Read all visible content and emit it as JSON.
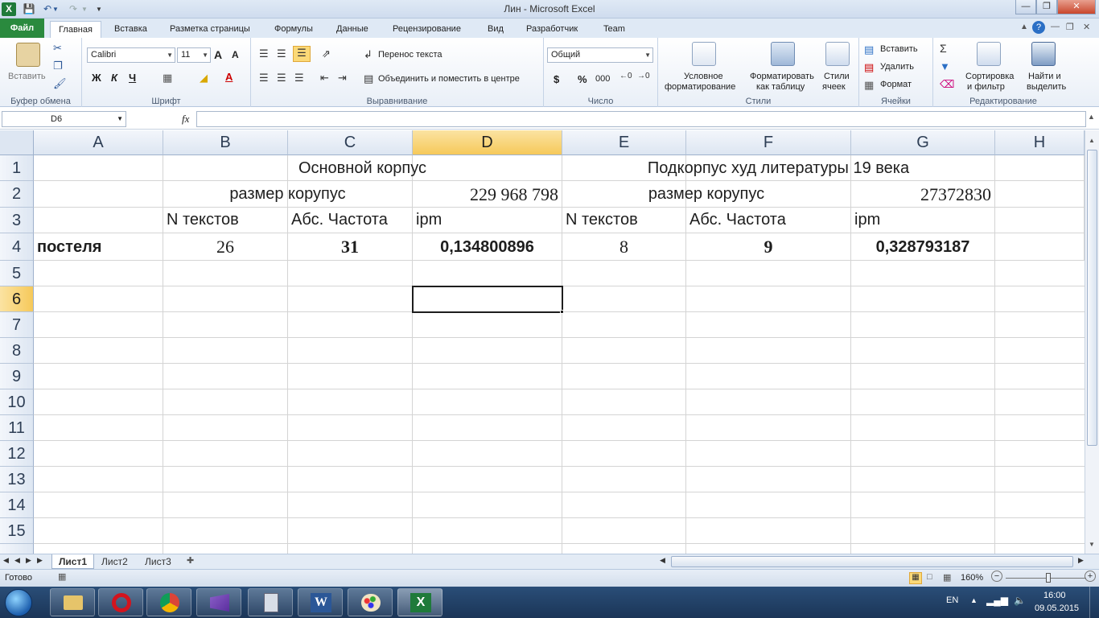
{
  "window": {
    "title": "Лин  -  Microsoft Excel"
  },
  "tabs": [
    "Файл",
    "Главная",
    "Вставка",
    "Разметка страницы",
    "Формулы",
    "Данные",
    "Рецензирование",
    "Вид",
    "Разработчик",
    "Team"
  ],
  "ribbon": {
    "clipboard": {
      "paste": "Вставить",
      "label": "Буфер обмена"
    },
    "font": {
      "name": "Calibri",
      "size": "11",
      "label": "Шрифт",
      "bold": "Ж",
      "italic": "К",
      "underline": "Ч"
    },
    "alignment": {
      "wrap": "Перенос текста",
      "merge": "Объединить и поместить в центре",
      "label": "Выравнивание"
    },
    "number": {
      "format": "Общий",
      "label": "Число",
      "currency": "$",
      "percent": "%",
      "thousands": "000"
    },
    "styles": {
      "conditional1": "Условное",
      "conditional2": "форматирование",
      "table1": "Форматировать",
      "table2": "как таблицу",
      "cell1": "Стили",
      "cell2": "ячеек",
      "label": "Стили"
    },
    "cells": {
      "insert": "Вставить",
      "delete": "Удалить",
      "format": "Формат",
      "label": "Ячейки"
    },
    "editing": {
      "sort1": "Сортировка",
      "sort2": "и фильтр",
      "find1": "Найти и",
      "find2": "выделить",
      "label": "Редактирование"
    }
  },
  "formula_bar": {
    "name_box": "D6",
    "fx": "fx",
    "value": ""
  },
  "columns": [
    "A",
    "B",
    "C",
    "D",
    "E",
    "F",
    "G",
    "H"
  ],
  "rows": [
    "1",
    "2",
    "3",
    "4",
    "5",
    "6",
    "7",
    "8",
    "9",
    "10",
    "11",
    "12",
    "13",
    "14",
    "15"
  ],
  "cells": {
    "B1": "Основной корпус",
    "E1": "Подкорпус худ литературы 19 века",
    "B2": "размер корупус",
    "D2": "229 968 798",
    "E2": "размер корупус",
    "G2": "27372830",
    "B3": "N текстов",
    "C3": "Абс. Частота",
    "D3": "ipm",
    "E3": "N текстов",
    "F3": "Абс. Частота",
    "G3": "ipm",
    "A4": "постеля",
    "B4": "26",
    "C4": "31",
    "D4": "0,134800896",
    "E4": "8",
    "F4": "9",
    "G4": "0,328793187"
  },
  "sheets": [
    "Лист1",
    "Лист2",
    "Лист3"
  ],
  "status": {
    "ready": "Готово",
    "zoom": "160%"
  },
  "tray": {
    "lang": "EN",
    "time": "16:00",
    "date": "09.05.2015"
  }
}
